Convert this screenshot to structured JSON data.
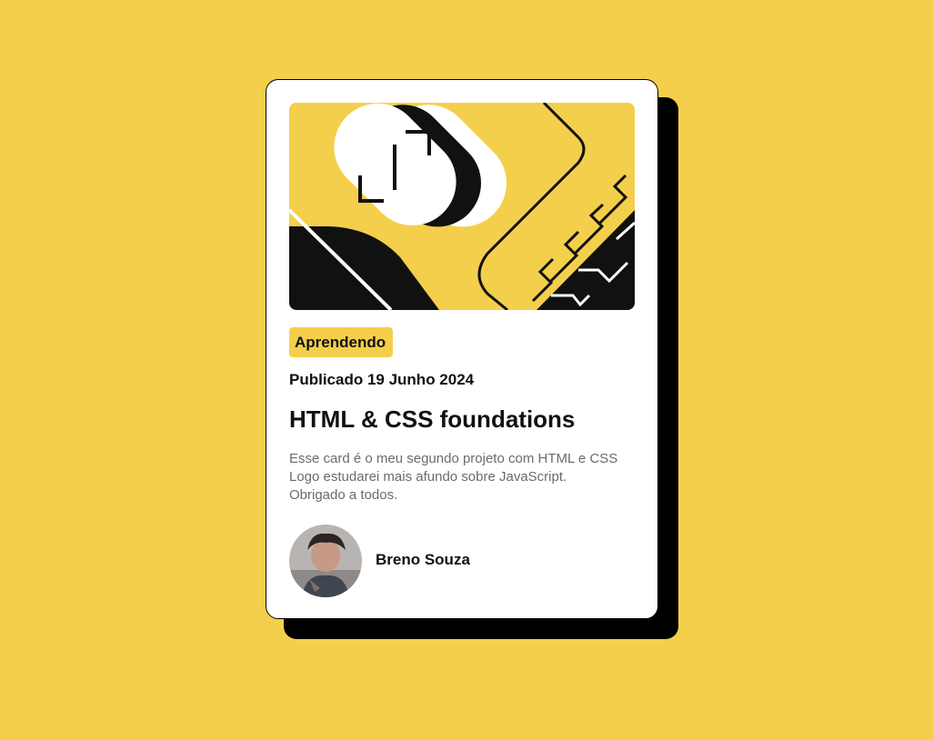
{
  "theme": {
    "background": "#F4CF4B",
    "card": "#FFFFFF",
    "shadow": "#000000",
    "text_dark": "#111111",
    "text_muted": "#6B6B6B",
    "tag_background": "#F4CF4B"
  },
  "card": {
    "illustration_icon": "abstract-geometric-illustration",
    "tag": "Aprendendo",
    "published": "Publicado 19 Junho 2024",
    "title": "HTML & CSS foundations",
    "description_lines": [
      "Esse card é o meu segundo projeto com HTML e CSS",
      "Logo estudarei mais afundo sobre JavaScript.",
      "Obrigado a todos."
    ],
    "author": {
      "avatar_icon": "profile-photo",
      "name": "Breno Souza"
    }
  }
}
